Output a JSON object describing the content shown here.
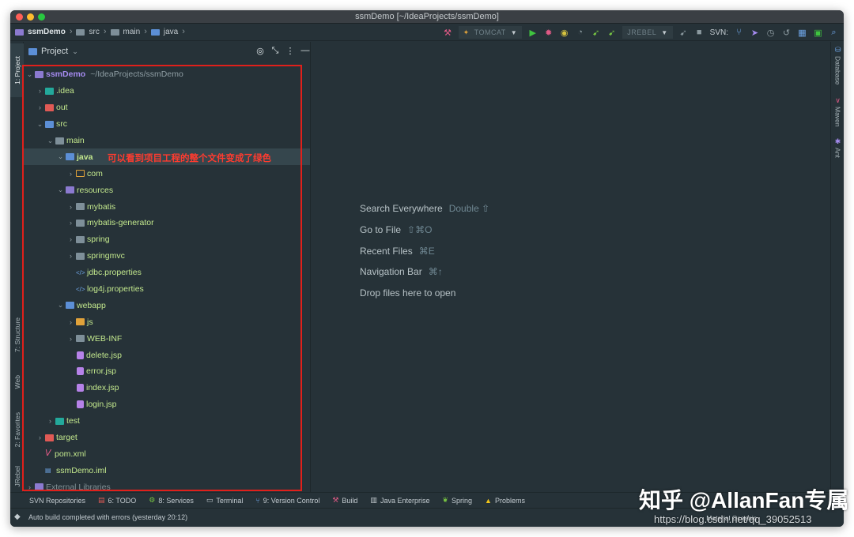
{
  "window": {
    "title": "ssmDemo [~/IdeaProjects/ssmDemo]"
  },
  "navbar": {
    "crumbs": [
      "ssmDemo",
      "src",
      "main",
      "java"
    ],
    "run_config": "TOMCAT",
    "jrebel_config": "JREBEL",
    "svn_label": "SVN:"
  },
  "left_strip": {
    "tabs": [
      "1: Project",
      "7: Structure",
      "Web",
      "2: Favorites",
      "JRebel"
    ]
  },
  "right_strip": {
    "tabs": [
      "Database",
      "Maven",
      "Ant"
    ]
  },
  "project_panel": {
    "title": "Project",
    "root": {
      "name": "ssmDemo",
      "path": "~/IdeaProjects/ssmDemo"
    },
    "items": [
      {
        "label": ".idea"
      },
      {
        "label": "out"
      },
      {
        "label": "src"
      },
      {
        "label": "main"
      },
      {
        "label": "java"
      },
      {
        "label": "com"
      },
      {
        "label": "resources"
      },
      {
        "label": "mybatis"
      },
      {
        "label": "mybatis-generator"
      },
      {
        "label": "spring"
      },
      {
        "label": "springmvc"
      },
      {
        "label": "jdbc.properties"
      },
      {
        "label": "log4j.properties"
      },
      {
        "label": "webapp"
      },
      {
        "label": "js"
      },
      {
        "label": "WEB-INF"
      },
      {
        "label": "delete.jsp"
      },
      {
        "label": "error.jsp"
      },
      {
        "label": "index.jsp"
      },
      {
        "label": "login.jsp"
      },
      {
        "label": "test"
      },
      {
        "label": "target"
      },
      {
        "label": "pom.xml"
      },
      {
        "label": "ssmDemo.iml"
      },
      {
        "label": "External Libraries"
      }
    ],
    "annotation": "可以看到项目工程的整个文件变成了绿色"
  },
  "editor": {
    "hints": [
      {
        "label": "Search Everywhere",
        "key": "Double ⇧"
      },
      {
        "label": "Go to File",
        "key": "⇧⌘O"
      },
      {
        "label": "Recent Files",
        "key": "⌘E"
      },
      {
        "label": "Navigation Bar",
        "key": "⌘↑"
      },
      {
        "label": "Drop files here to open",
        "key": ""
      }
    ]
  },
  "bottom_bar": {
    "tabs": [
      "SVN Repositories",
      "6: TODO",
      "8: Services",
      "Terminal",
      "9: Version Control",
      "Build",
      "Java Enterprise",
      "Spring",
      "Problems"
    ]
  },
  "status_bar": {
    "message": "Auto build completed with errors (yesterday 20:12)",
    "theme": "Material Oceanic"
  },
  "watermark": {
    "zhihu": "知乎 @AllanFan专属",
    "url": "https://blog.csdn.net/qq_39052513"
  },
  "colors": {
    "background": "#263238",
    "vcs_added_green": "#c3e88d",
    "annotation_red": "#e0201b",
    "accent_folder_blue": "#5c8fd6"
  }
}
